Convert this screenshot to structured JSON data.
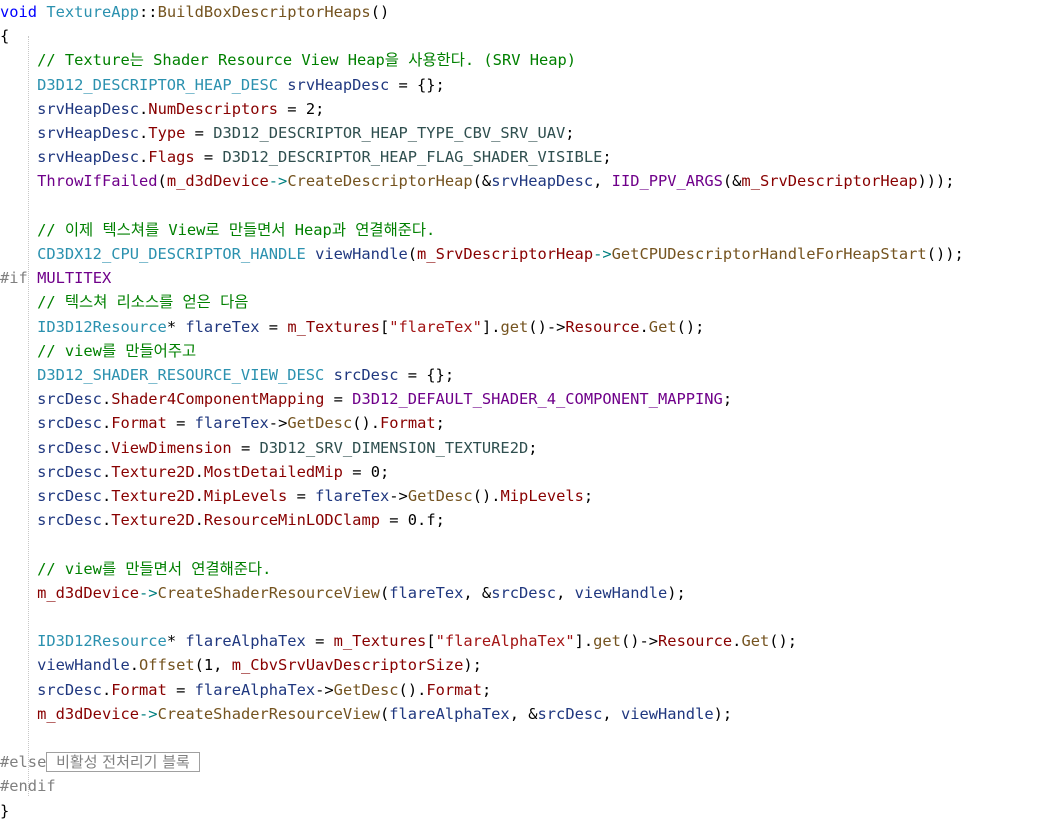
{
  "colors": {
    "background": "#ffffff",
    "keyword": "#0000ff",
    "type": "#2b91af",
    "variable": "#1f377f",
    "function": "#74531f",
    "member": "#880000",
    "macro": "#6f008a",
    "enum": "#2f4f4f",
    "operator": "#008080",
    "string": "#a31515",
    "comment": "#008000",
    "preprocessor": "#808080",
    "plain": "#000000"
  },
  "code_lines": [
    [
      [
        "kw",
        "void"
      ],
      [
        "pln",
        " "
      ],
      [
        "cls",
        "TextureApp"
      ],
      [
        "pln",
        "::"
      ],
      [
        "fn",
        "BuildBoxDescriptorHeaps"
      ],
      [
        "pln",
        "()"
      ]
    ],
    [
      [
        "pln",
        "{"
      ]
    ],
    [
      [
        "pln",
        "    "
      ],
      [
        "cmt",
        "// Texture는 Shader Resource View Heap을 사용한다. (SRV Heap)"
      ]
    ],
    [
      [
        "pln",
        "    "
      ],
      [
        "cls",
        "D3D12_DESCRIPTOR_HEAP_DESC"
      ],
      [
        "pln",
        " "
      ],
      [
        "var",
        "srvHeapDesc"
      ],
      [
        "pln",
        " = {};"
      ]
    ],
    [
      [
        "pln",
        "    "
      ],
      [
        "var",
        "srvHeapDesc"
      ],
      [
        "pln",
        "."
      ],
      [
        "mem",
        "NumDescriptors"
      ],
      [
        "pln",
        " = 2;"
      ]
    ],
    [
      [
        "pln",
        "    "
      ],
      [
        "var",
        "srvHeapDesc"
      ],
      [
        "pln",
        "."
      ],
      [
        "mem",
        "Type"
      ],
      [
        "pln",
        " = "
      ],
      [
        "enum",
        "D3D12_DESCRIPTOR_HEAP_TYPE_CBV_SRV_UAV"
      ],
      [
        "pln",
        ";"
      ]
    ],
    [
      [
        "pln",
        "    "
      ],
      [
        "var",
        "srvHeapDesc"
      ],
      [
        "pln",
        "."
      ],
      [
        "mem",
        "Flags"
      ],
      [
        "pln",
        " = "
      ],
      [
        "enum",
        "D3D12_DESCRIPTOR_HEAP_FLAG_SHADER_VISIBLE"
      ],
      [
        "pln",
        ";"
      ]
    ],
    [
      [
        "pln",
        "    "
      ],
      [
        "mac",
        "ThrowIfFailed"
      ],
      [
        "pln",
        "("
      ],
      [
        "mem",
        "m_d3dDevice"
      ],
      [
        "op",
        "->"
      ],
      [
        "fn",
        "CreateDescriptorHeap"
      ],
      [
        "pln",
        "(&"
      ],
      [
        "var",
        "srvHeapDesc"
      ],
      [
        "pln",
        ", "
      ],
      [
        "mac",
        "IID_PPV_ARGS"
      ],
      [
        "pln",
        "(&"
      ],
      [
        "mem",
        "m_SrvDescriptorHeap"
      ],
      [
        "pln",
        ")));"
      ]
    ],
    [
      [
        "pln",
        ""
      ]
    ],
    [
      [
        "pln",
        "    "
      ],
      [
        "cmt",
        "// 이제 텍스쳐를 View로 만들면서 Heap과 연결해준다."
      ]
    ],
    [
      [
        "pln",
        "    "
      ],
      [
        "cls",
        "CD3DX12_CPU_DESCRIPTOR_HANDLE"
      ],
      [
        "pln",
        " "
      ],
      [
        "var",
        "viewHandle"
      ],
      [
        "pln",
        "("
      ],
      [
        "mem",
        "m_SrvDescriptorHeap"
      ],
      [
        "op",
        "->"
      ],
      [
        "fn",
        "GetCPUDescriptorHandleForHeapStart"
      ],
      [
        "pln",
        "());"
      ]
    ],
    [
      [
        "pre",
        "#if"
      ],
      [
        "pln",
        " "
      ],
      [
        "mac",
        "MULTITEX"
      ]
    ],
    [
      [
        "pln",
        "    "
      ],
      [
        "cmt",
        "// 텍스쳐 리소스를 얻은 다음"
      ]
    ],
    [
      [
        "pln",
        "    "
      ],
      [
        "cls",
        "ID3D12Resource"
      ],
      [
        "pln",
        "* "
      ],
      [
        "var",
        "flareTex"
      ],
      [
        "pln",
        " = "
      ],
      [
        "mem",
        "m_Textures"
      ],
      [
        "pln",
        "["
      ],
      [
        "str",
        "\"flareTex\""
      ],
      [
        "pln",
        "]."
      ],
      [
        "fn",
        "get"
      ],
      [
        "pln",
        "()->"
      ],
      [
        "mem",
        "Resource"
      ],
      [
        "pln",
        "."
      ],
      [
        "fn",
        "Get"
      ],
      [
        "pln",
        "();"
      ]
    ],
    [
      [
        "pln",
        "    "
      ],
      [
        "cmt",
        "// view를 만들어주고"
      ]
    ],
    [
      [
        "pln",
        "    "
      ],
      [
        "cls",
        "D3D12_SHADER_RESOURCE_VIEW_DESC"
      ],
      [
        "pln",
        " "
      ],
      [
        "var",
        "srcDesc"
      ],
      [
        "pln",
        " = {};"
      ]
    ],
    [
      [
        "pln",
        "    "
      ],
      [
        "var",
        "srcDesc"
      ],
      [
        "pln",
        "."
      ],
      [
        "mem",
        "Shader4ComponentMapping"
      ],
      [
        "pln",
        " = "
      ],
      [
        "mac",
        "D3D12_DEFAULT_SHADER_4_COMPONENT_MAPPING"
      ],
      [
        "pln",
        ";"
      ]
    ],
    [
      [
        "pln",
        "    "
      ],
      [
        "var",
        "srcDesc"
      ],
      [
        "pln",
        "."
      ],
      [
        "mem",
        "Format"
      ],
      [
        "pln",
        " = "
      ],
      [
        "var",
        "flareTex"
      ],
      [
        "pln",
        "->"
      ],
      [
        "fn",
        "GetDesc"
      ],
      [
        "pln",
        "()."
      ],
      [
        "mem",
        "Format"
      ],
      [
        "pln",
        ";"
      ]
    ],
    [
      [
        "pln",
        "    "
      ],
      [
        "var",
        "srcDesc"
      ],
      [
        "pln",
        "."
      ],
      [
        "mem",
        "ViewDimension"
      ],
      [
        "pln",
        " = "
      ],
      [
        "enum",
        "D3D12_SRV_DIMENSION_TEXTURE2D"
      ],
      [
        "pln",
        ";"
      ]
    ],
    [
      [
        "pln",
        "    "
      ],
      [
        "var",
        "srcDesc"
      ],
      [
        "pln",
        "."
      ],
      [
        "mem",
        "Texture2D"
      ],
      [
        "pln",
        "."
      ],
      [
        "mem",
        "MostDetailedMip"
      ],
      [
        "pln",
        " = 0;"
      ]
    ],
    [
      [
        "pln",
        "    "
      ],
      [
        "var",
        "srcDesc"
      ],
      [
        "pln",
        "."
      ],
      [
        "mem",
        "Texture2D"
      ],
      [
        "pln",
        "."
      ],
      [
        "mem",
        "MipLevels"
      ],
      [
        "pln",
        " = "
      ],
      [
        "var",
        "flareTex"
      ],
      [
        "pln",
        "->"
      ],
      [
        "fn",
        "GetDesc"
      ],
      [
        "pln",
        "()."
      ],
      [
        "mem",
        "MipLevels"
      ],
      [
        "pln",
        ";"
      ]
    ],
    [
      [
        "pln",
        "    "
      ],
      [
        "var",
        "srcDesc"
      ],
      [
        "pln",
        "."
      ],
      [
        "mem",
        "Texture2D"
      ],
      [
        "pln",
        "."
      ],
      [
        "mem",
        "ResourceMinLODClamp"
      ],
      [
        "pln",
        " = 0.f;"
      ]
    ],
    [
      [
        "pln",
        ""
      ]
    ],
    [
      [
        "pln",
        "    "
      ],
      [
        "cmt",
        "// view를 만들면서 연결해준다."
      ]
    ],
    [
      [
        "pln",
        "    "
      ],
      [
        "mem",
        "m_d3dDevice"
      ],
      [
        "op",
        "->"
      ],
      [
        "fn",
        "CreateShaderResourceView"
      ],
      [
        "pln",
        "("
      ],
      [
        "var",
        "flareTex"
      ],
      [
        "pln",
        ", &"
      ],
      [
        "var",
        "srcDesc"
      ],
      [
        "pln",
        ", "
      ],
      [
        "var",
        "viewHandle"
      ],
      [
        "pln",
        ");"
      ]
    ],
    [
      [
        "pln",
        ""
      ]
    ],
    [
      [
        "pln",
        "    "
      ],
      [
        "cls",
        "ID3D12Resource"
      ],
      [
        "pln",
        "* "
      ],
      [
        "var",
        "flareAlphaTex"
      ],
      [
        "pln",
        " = "
      ],
      [
        "mem",
        "m_Textures"
      ],
      [
        "pln",
        "["
      ],
      [
        "str",
        "\"flareAlphaTex\""
      ],
      [
        "pln",
        "]."
      ],
      [
        "fn",
        "get"
      ],
      [
        "pln",
        "()->"
      ],
      [
        "mem",
        "Resource"
      ],
      [
        "pln",
        "."
      ],
      [
        "fn",
        "Get"
      ],
      [
        "pln",
        "();"
      ]
    ],
    [
      [
        "pln",
        "    "
      ],
      [
        "var",
        "viewHandle"
      ],
      [
        "pln",
        "."
      ],
      [
        "fn",
        "Offset"
      ],
      [
        "pln",
        "(1, "
      ],
      [
        "mem",
        "m_CbvSrvUavDescriptorSize"
      ],
      [
        "pln",
        ");"
      ]
    ],
    [
      [
        "pln",
        "    "
      ],
      [
        "var",
        "srcDesc"
      ],
      [
        "pln",
        "."
      ],
      [
        "mem",
        "Format"
      ],
      [
        "pln",
        " = "
      ],
      [
        "var",
        "flareAlphaTex"
      ],
      [
        "pln",
        "->"
      ],
      [
        "fn",
        "GetDesc"
      ],
      [
        "pln",
        "()."
      ],
      [
        "mem",
        "Format"
      ],
      [
        "pln",
        ";"
      ]
    ],
    [
      [
        "pln",
        "    "
      ],
      [
        "mem",
        "m_d3dDevice"
      ],
      [
        "op",
        "->"
      ],
      [
        "fn",
        "CreateShaderResourceView"
      ],
      [
        "pln",
        "("
      ],
      [
        "var",
        "flareAlphaTex"
      ],
      [
        "pln",
        ", &"
      ],
      [
        "var",
        "srcDesc"
      ],
      [
        "pln",
        ", "
      ],
      [
        "var",
        "viewHandle"
      ],
      [
        "pln",
        ");"
      ]
    ],
    [
      [
        "pln",
        ""
      ]
    ],
    [
      [
        "pre",
        "#else"
      ],
      [
        "box",
        " 비활성 전처리기 블록 "
      ]
    ],
    [
      [
        "pre",
        "#endif"
      ]
    ],
    [
      [
        "pln",
        "}"
      ]
    ]
  ]
}
